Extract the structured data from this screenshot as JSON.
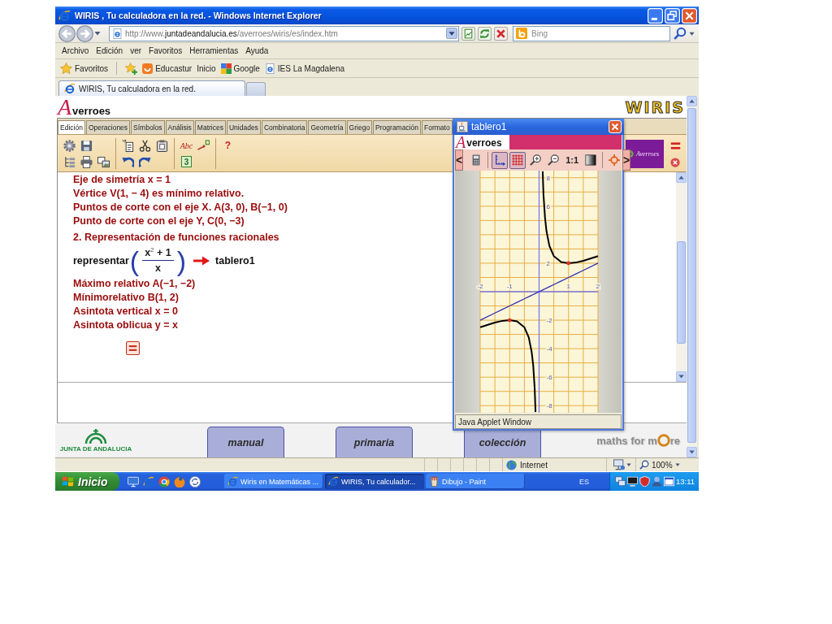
{
  "window": {
    "title": "WIRIS , Tu calculadora en la red. - Windows Internet Explorer"
  },
  "address_bar": {
    "url": "http://www.**juntadeandalucia.es**/averroes/wiris/es/index.htm",
    "search_placeholder": "Bing"
  },
  "menu": [
    "Archivo",
    "Edición",
    "ver",
    "Favoritos",
    "Herramientas",
    "Ayuda"
  ],
  "favorites_bar": {
    "label": "Favoritos",
    "links": [
      {
        "kind": "smile",
        "label": "Educastur"
      },
      {
        "kind": "plain",
        "label": "Inicio"
      },
      {
        "kind": "squares",
        "label": "Google"
      },
      {
        "kind": "page",
        "label": "IES La Magdalena"
      }
    ]
  },
  "browser_tabs": [
    {
      "label": "WIRIS, Tu calculadora en la red.",
      "selected": true
    }
  ],
  "page": {
    "logo": {
      "initial": "A",
      "rest": "verroes"
    },
    "brand": "WIRIS",
    "tabs": [
      {
        "label": "Edición",
        "selected": true
      },
      {
        "label": "Operaciones",
        "selected": false
      },
      {
        "label": "Símbolos",
        "selected": false
      },
      {
        "label": "Análisis",
        "selected": false
      },
      {
        "label": "Matrices",
        "selected": false
      },
      {
        "label": "Unidades",
        "selected": false
      },
      {
        "label": "Combinatoria",
        "selected": false
      },
      {
        "label": "Geometría",
        "selected": false
      },
      {
        "label": "Griego",
        "selected": false
      },
      {
        "label": "Programación",
        "selected": false
      },
      {
        "label": "Formato",
        "selected": false
      }
    ],
    "toolbar_groups": [
      {
        "top": [
          {
            "kind": "new"
          },
          {
            "kind": "save"
          }
        ],
        "bottom": [
          {
            "kind": "tree"
          },
          {
            "kind": "print"
          },
          {
            "kind": "image"
          }
        ]
      },
      {
        "top": [
          {
            "kind": "paste"
          },
          {
            "kind": "cut"
          },
          {
            "kind": "copy"
          }
        ],
        "bottom": [
          {
            "kind": "undo"
          },
          {
            "kind": "redo"
          }
        ]
      },
      {
        "top": [
          {
            "kind": "text",
            "label": "Abc"
          },
          {
            "kind": "power"
          }
        ],
        "bottom": [
          {
            "kind": "number",
            "label": "3"
          }
        ]
      },
      {
        "top": [
          {
            "kind": "help",
            "label": "?"
          }
        ]
      }
    ],
    "side_logo": "Averroes",
    "editor": [
      {
        "kind": "text",
        "text": "Eje de simetría x = 1"
      },
      {
        "kind": "text",
        "text": "Vértice V(1, − 4) es mínimo relativo."
      },
      {
        "kind": "text",
        "text": "Puntos de corte con el eje X. A(3, 0), B(−1, 0)"
      },
      {
        "kind": "text",
        "text": "Punto de corte con el eje Y, C(0, −3)"
      },
      {
        "kind": "heading",
        "text": "2. Representación de funciones racionales"
      },
      {
        "kind": "formula",
        "function": "representar",
        "open": "(",
        "numerator": "x$^{2}$ + 1",
        "denominator": "x",
        "close": ")",
        "result": "tablero1"
      },
      {
        "kind": "text",
        "text": "Máximo relativo A(−1, −2)"
      },
      {
        "kind": "text",
        "text": "Mínimorelativo B(1, 2)"
      },
      {
        "kind": "text",
        "text": "Asintota vertical x = 0"
      },
      {
        "kind": "text",
        "text": "Asintota oblicua y = x"
      },
      {
        "kind": "calc"
      }
    ],
    "footer_logo": "JUNTA DE ANDALUCIA",
    "nav_tabs": [
      "manual",
      "primaria",
      "colección"
    ],
    "maths_brand": {
      "before": "maths for m",
      "after": "re"
    }
  },
  "tablero": {
    "title": "tablero1",
    "logo": {
      "initial": "A",
      "rest": "verroes"
    },
    "prev": "<",
    "next": ">",
    "tools": [
      {
        "kind": "calculator",
        "on": false
      },
      {
        "kind": "axes",
        "on": true
      },
      {
        "kind": "grid",
        "on": true
      },
      {
        "kind": "zoom-in",
        "on": false
      },
      {
        "kind": "zoom-out",
        "on": false
      },
      {
        "kind": "scale",
        "label": "1:1",
        "on": false
      },
      {
        "kind": "shade",
        "on": false
      },
      {
        "kind": "center",
        "on": false
      }
    ],
    "chart_data": {
      "type": "line",
      "x": [
        -2,
        -1.5,
        -1.25,
        -1,
        -0.75,
        -0.5,
        -0.35,
        -0.25,
        -0.2,
        -0.15,
        -0.12,
        0,
        0.12,
        0.15,
        0.2,
        0.25,
        0.35,
        0.5,
        0.75,
        1,
        1.25,
        1.5,
        2
      ],
      "series": [
        {
          "color": "#000000",
          "values": [
            -2.5,
            -2.17,
            -2.05,
            -2,
            -2.08,
            -2.5,
            -3.21,
            -4.25,
            -5.2,
            -6.82,
            -8.45,
            null,
            8.45,
            6.82,
            5.2,
            4.25,
            3.21,
            2.5,
            2.08,
            2,
            2.05,
            2.17,
            2.5
          ]
        },
        {
          "color": "#2c2cb4",
          "values": [
            -2,
            -1.5,
            -1.25,
            -1,
            -0.75,
            -0.5,
            -0.35,
            -0.25,
            -0.2,
            -0.15,
            -0.12,
            0,
            0.12,
            0.15,
            0.2,
            0.25,
            0.35,
            0.5,
            0.75,
            1,
            1.25,
            1.5,
            2
          ]
        }
      ],
      "xlim": [
        -2,
        2
      ],
      "ylim": [
        -8.5,
        8.5
      ],
      "xticks": [
        -2,
        -1,
        1,
        2
      ],
      "yticks": [
        8,
        6,
        2,
        -2,
        -4,
        -6,
        -8
      ],
      "grid": true
    },
    "status": "Java Applet Window"
  },
  "status_bar": {
    "zone": "Internet",
    "zoom": "100%"
  },
  "taskbar": {
    "start": "Inicio",
    "quick_launch": [
      {
        "kind": "desktop"
      },
      {
        "kind": "ie"
      },
      {
        "kind": "chrome"
      },
      {
        "kind": "firefox"
      },
      {
        "kind": "sync"
      }
    ],
    "tasks": [
      {
        "kind": "ie",
        "label": "Wiris en Matemáticas ...",
        "selected": false
      },
      {
        "kind": "ie",
        "label": "WIRIS, Tu calculador...",
        "selected": true
      },
      {
        "kind": "paint",
        "label": "Dibujo - Paint",
        "selected": false
      }
    ],
    "language": "ES",
    "tray": [
      {
        "kind": "network"
      },
      {
        "kind": "monitor"
      },
      {
        "kind": "shield"
      },
      {
        "kind": "person"
      },
      {
        "kind": "window"
      }
    ],
    "clock": "13:11"
  }
}
